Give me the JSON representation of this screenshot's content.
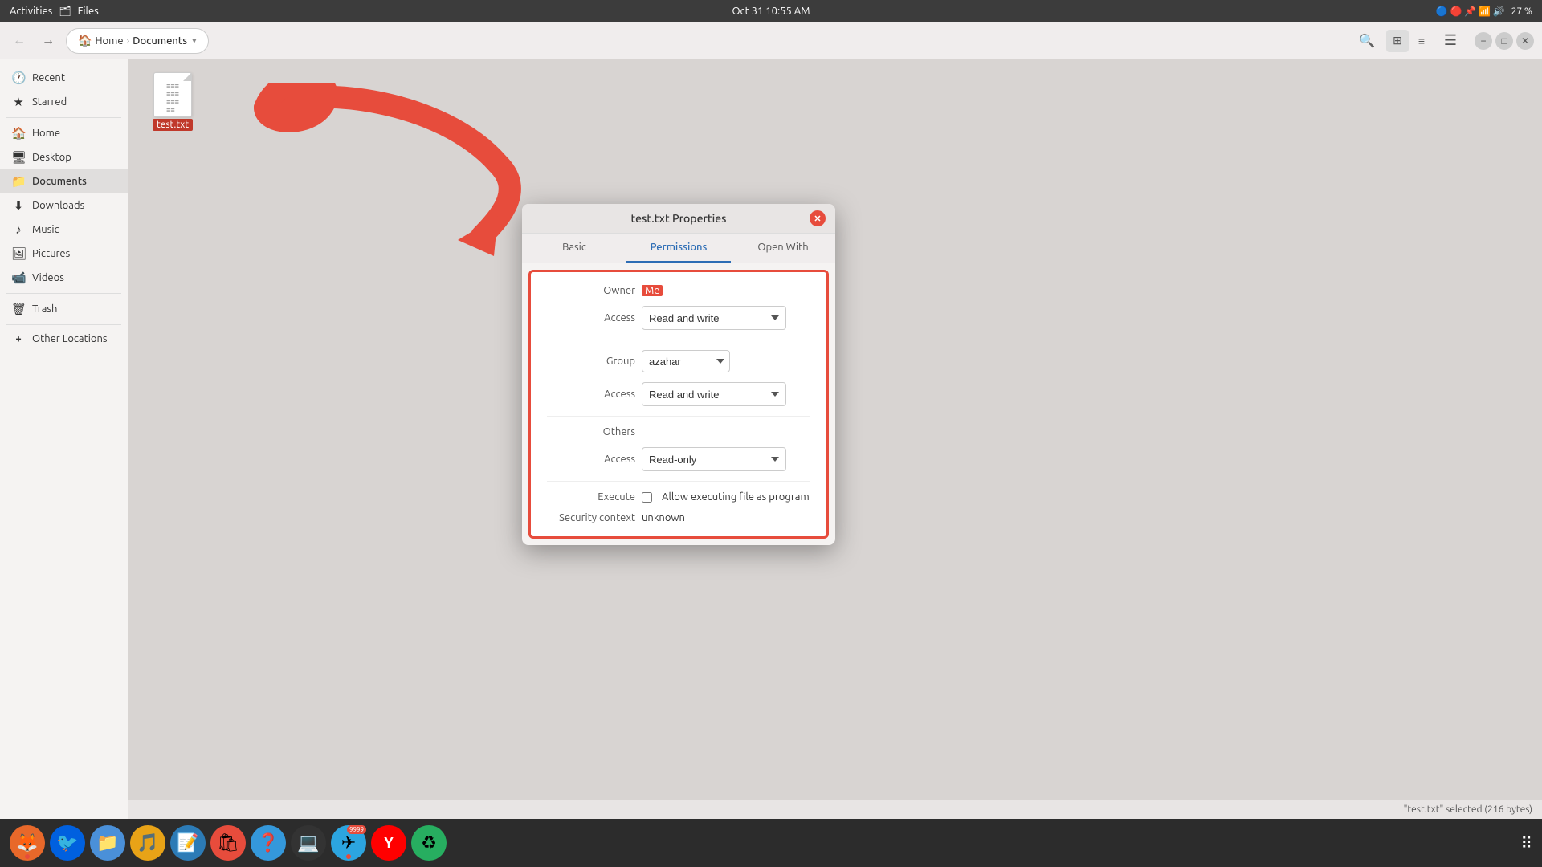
{
  "topbar": {
    "activities": "Activities",
    "files": "Files",
    "datetime": "Oct 31  10:55 AM",
    "battery": "27 %"
  },
  "toolbar": {
    "home_label": "Home",
    "documents_label": "Documents",
    "back_label": "←",
    "forward_label": "→"
  },
  "sidebar": {
    "items": [
      {
        "label": "Recent",
        "icon": "🕐",
        "id": "recent"
      },
      {
        "label": "Starred",
        "icon": "★",
        "id": "starred"
      },
      {
        "label": "Home",
        "icon": "🏠",
        "id": "home"
      },
      {
        "label": "Desktop",
        "icon": "🖥",
        "id": "desktop"
      },
      {
        "label": "Documents",
        "icon": "📁",
        "id": "documents"
      },
      {
        "label": "Downloads",
        "icon": "⬇",
        "id": "downloads"
      },
      {
        "label": "Music",
        "icon": "♪",
        "id": "music"
      },
      {
        "label": "Pictures",
        "icon": "🖼",
        "id": "pictures"
      },
      {
        "label": "Videos",
        "icon": "📹",
        "id": "videos"
      },
      {
        "label": "Trash",
        "icon": "🗑",
        "id": "trash"
      },
      {
        "label": "Other Locations",
        "icon": "+",
        "id": "other"
      }
    ]
  },
  "file": {
    "name": "test.txt",
    "label": "test.txt"
  },
  "dialog": {
    "title": "test.txt Properties",
    "tabs": [
      {
        "label": "Basic",
        "id": "basic"
      },
      {
        "label": "Permissions",
        "id": "permissions"
      },
      {
        "label": "Open With",
        "id": "openwith"
      }
    ],
    "active_tab": "Permissions",
    "permissions": {
      "owner_label": "Owner",
      "owner_value": "Me",
      "owner_access_label": "Access",
      "owner_access_value": "Read and write",
      "group_label": "Group",
      "group_value": "azahar",
      "group_access_label": "Access",
      "group_access_value": "Read and write",
      "others_label": "Others",
      "others_access_label": "Access",
      "others_access_value": "Read-only",
      "execute_label": "Execute",
      "execute_checkbox_label": "Allow executing file as program",
      "security_label": "Security context",
      "security_value": "unknown"
    }
  },
  "statusbar": {
    "text": "\"test.txt\" selected (216 bytes)"
  },
  "taskbar": {
    "apps": [
      {
        "name": "firefox",
        "icon": "🦊",
        "dot": true
      },
      {
        "name": "thunderbird",
        "icon": "🐦",
        "dot": false
      },
      {
        "name": "files",
        "icon": "📁",
        "dot": false
      },
      {
        "name": "rhythmbox",
        "icon": "🎵",
        "dot": false
      },
      {
        "name": "libreoffice-writer",
        "icon": "📝",
        "dot": false
      },
      {
        "name": "app-center",
        "icon": "🛍",
        "dot": false
      },
      {
        "name": "help",
        "icon": "❓",
        "dot": false
      },
      {
        "name": "terminal",
        "icon": "💻",
        "dot": false
      },
      {
        "name": "telegram",
        "icon": "✈",
        "dot": true,
        "badge": ""
      },
      {
        "name": "yandex-browser",
        "icon": "Y",
        "dot": false
      },
      {
        "name": "recycle",
        "icon": "♻",
        "dot": false
      }
    ],
    "grid_icon": "⋮⋮⋮"
  }
}
